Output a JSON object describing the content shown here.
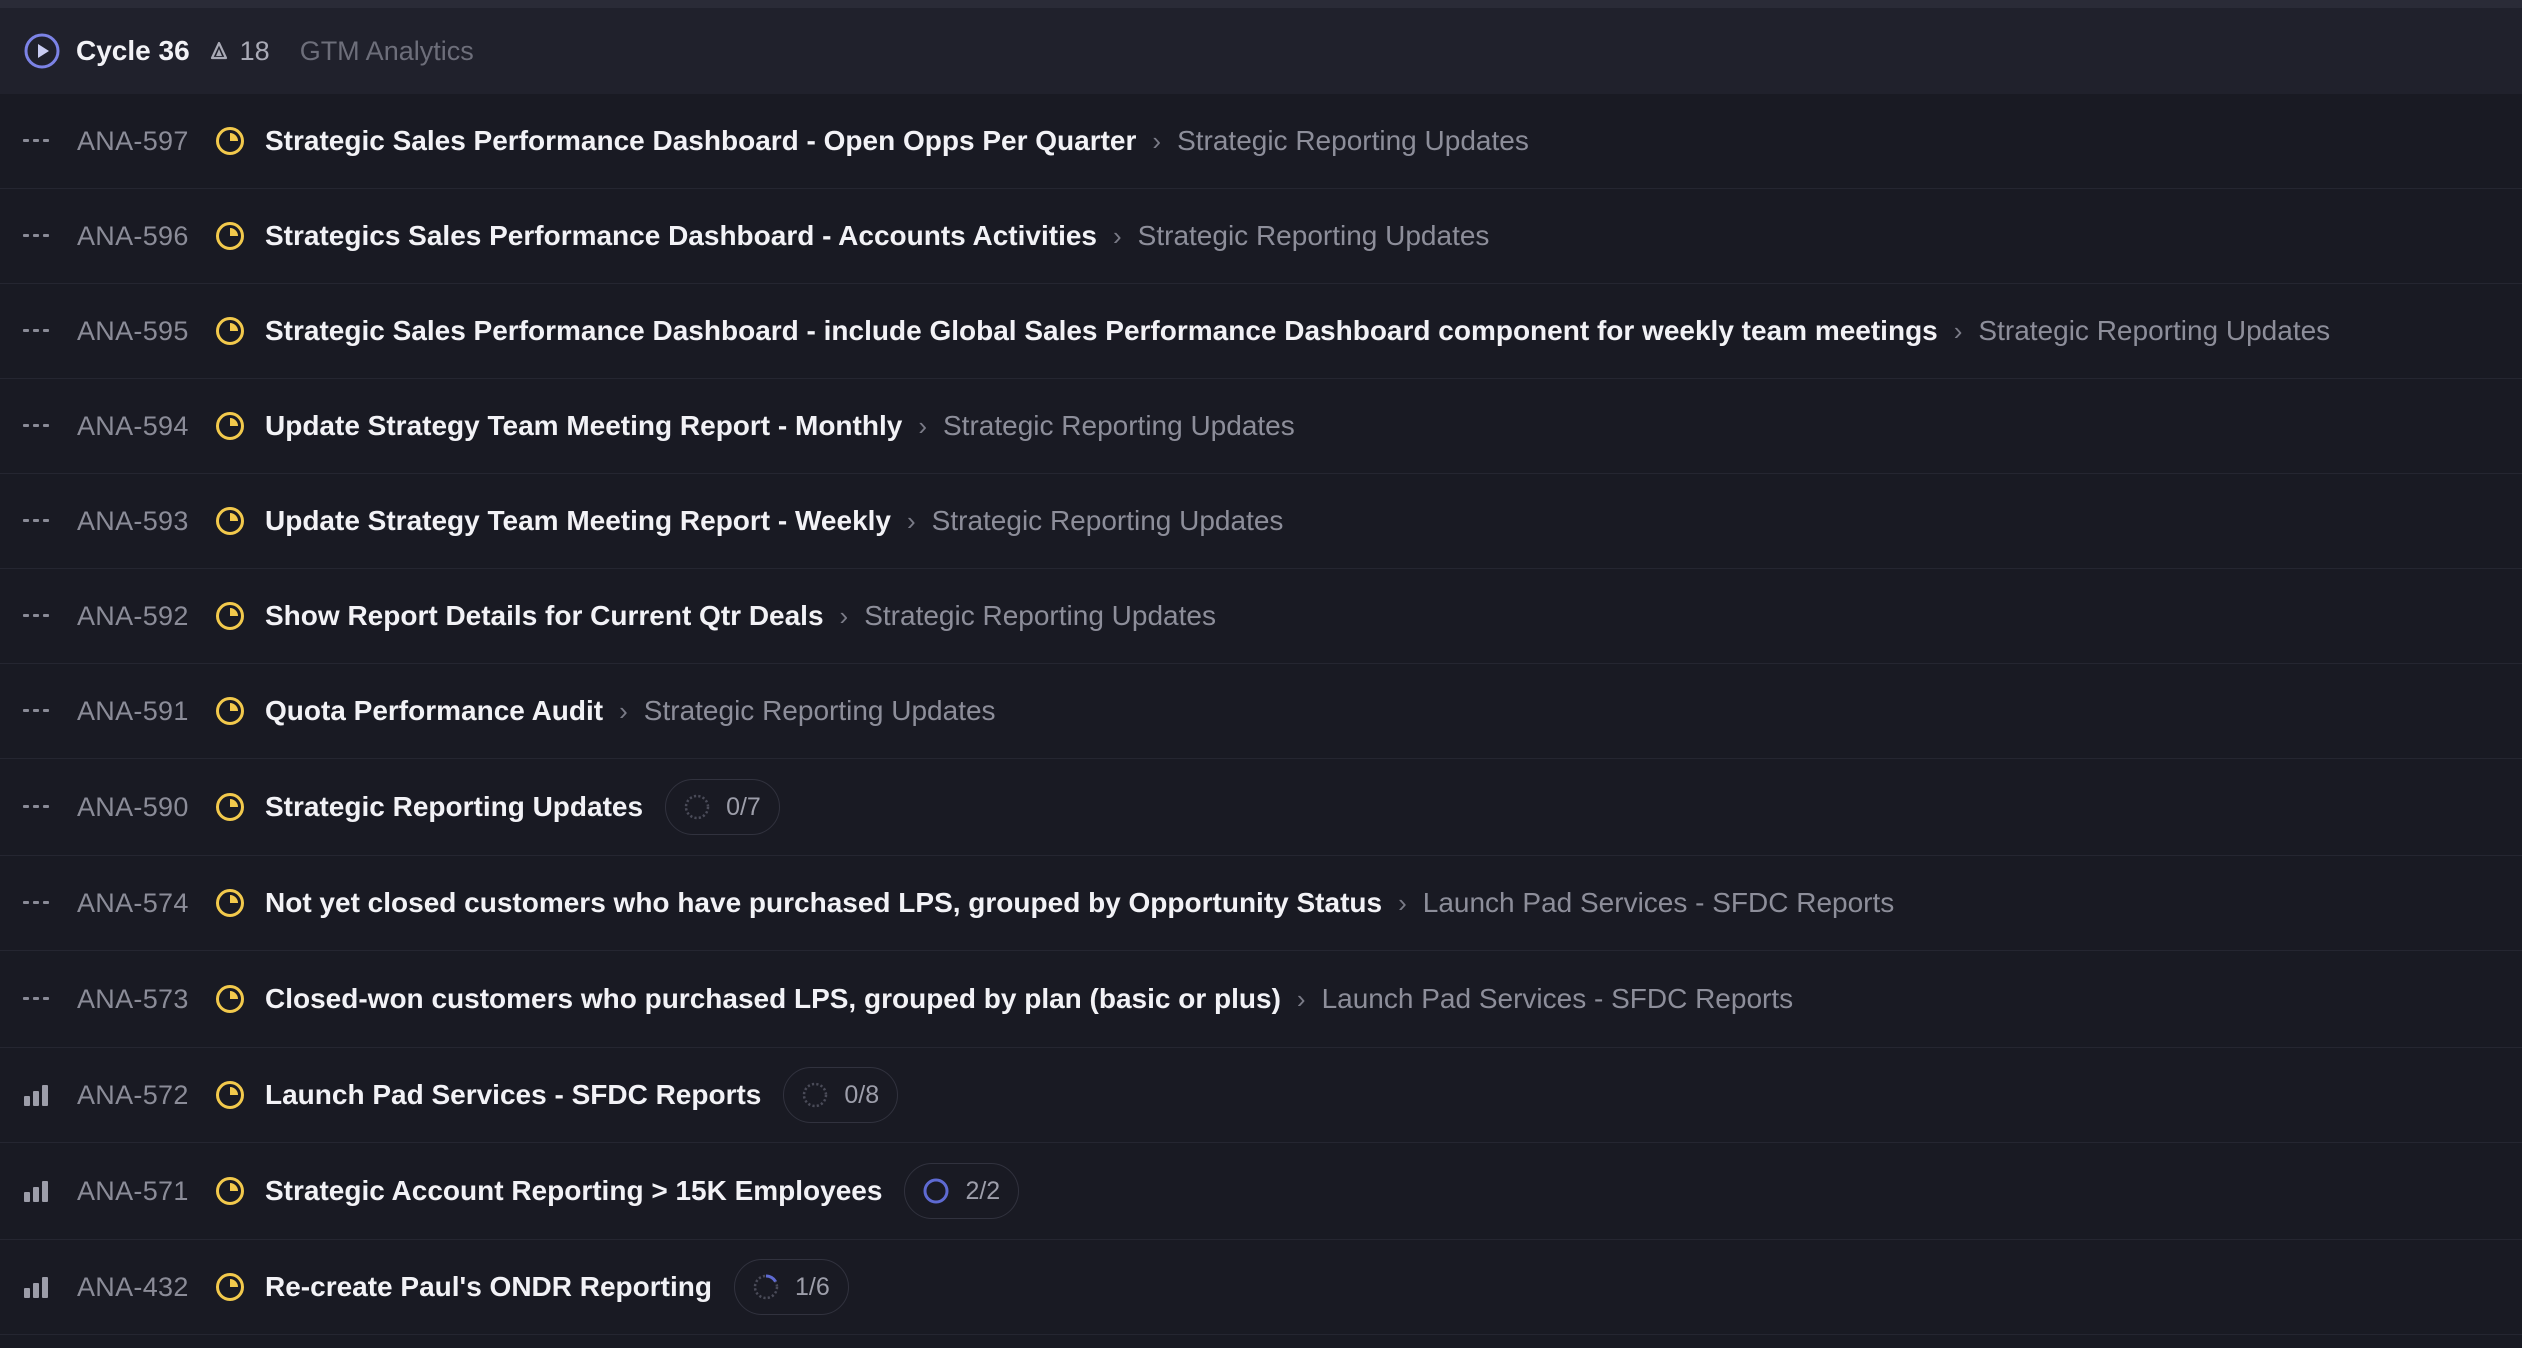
{
  "group": {
    "icon": "cycle-icon",
    "title": "Cycle 36",
    "count": "18",
    "team": "GTM Analytics"
  },
  "colors": {
    "in_progress_status": "#f2c94c",
    "progress_ring": "#5e6ad2",
    "cycle_icon": "#7c83e6"
  },
  "issues": [
    {
      "priority": "no-priority",
      "id": "ANA-597",
      "status": "in-progress",
      "title": "Strategic Sales Performance Dashboard - Open Opps Per Quarter",
      "parent": "Strategic Reporting Updates"
    },
    {
      "priority": "no-priority",
      "id": "ANA-596",
      "status": "in-progress",
      "title": "Strategics Sales Performance Dashboard - Accounts Activities",
      "parent": "Strategic Reporting Updates"
    },
    {
      "priority": "no-priority",
      "id": "ANA-595",
      "status": "in-progress",
      "title": "Strategic Sales Performance Dashboard - include Global Sales Performance Dashboard component for weekly team meetings",
      "parent": "Strategic Reporting Updates"
    },
    {
      "priority": "no-priority",
      "id": "ANA-594",
      "status": "in-progress",
      "title": "Update Strategy Team Meeting Report - Monthly",
      "parent": "Strategic Reporting Updates"
    },
    {
      "priority": "no-priority",
      "id": "ANA-593",
      "status": "in-progress",
      "title": "Update Strategy Team Meeting Report - Weekly",
      "parent": "Strategic Reporting Updates"
    },
    {
      "priority": "no-priority",
      "id": "ANA-592",
      "status": "in-progress",
      "title": "Show Report Details for Current Qtr Deals",
      "parent": "Strategic Reporting Updates"
    },
    {
      "priority": "no-priority",
      "id": "ANA-591",
      "status": "in-progress",
      "title": "Quota Performance Audit",
      "parent": "Strategic Reporting Updates"
    },
    {
      "priority": "no-priority",
      "id": "ANA-590",
      "status": "in-progress",
      "title": "Strategic Reporting Updates",
      "sub_issues": "0/7",
      "sub_progress": 0
    },
    {
      "priority": "no-priority",
      "id": "ANA-574",
      "status": "in-progress",
      "title": "Not yet closed customers who have purchased LPS, grouped by Opportunity Status",
      "parent": "Launch Pad Services - SFDC Reports"
    },
    {
      "priority": "no-priority",
      "id": "ANA-573",
      "status": "in-progress",
      "title": "Closed-won customers who purchased LPS, grouped by plan (basic or plus)",
      "parent": "Launch Pad Services - SFDC Reports"
    },
    {
      "priority": "high",
      "id": "ANA-572",
      "status": "in-progress",
      "title": "Launch Pad Services - SFDC Reports",
      "sub_issues": "0/8",
      "sub_progress": 0
    },
    {
      "priority": "high",
      "id": "ANA-571",
      "status": "in-progress",
      "title": "Strategic Account Reporting > 15K Employees",
      "sub_issues": "2/2",
      "sub_progress": 1
    },
    {
      "priority": "high",
      "id": "ANA-432",
      "status": "in-progress",
      "title": "Re-create Paul's ONDR Reporting",
      "sub_issues": "1/6",
      "sub_progress": 0.1667
    }
  ]
}
